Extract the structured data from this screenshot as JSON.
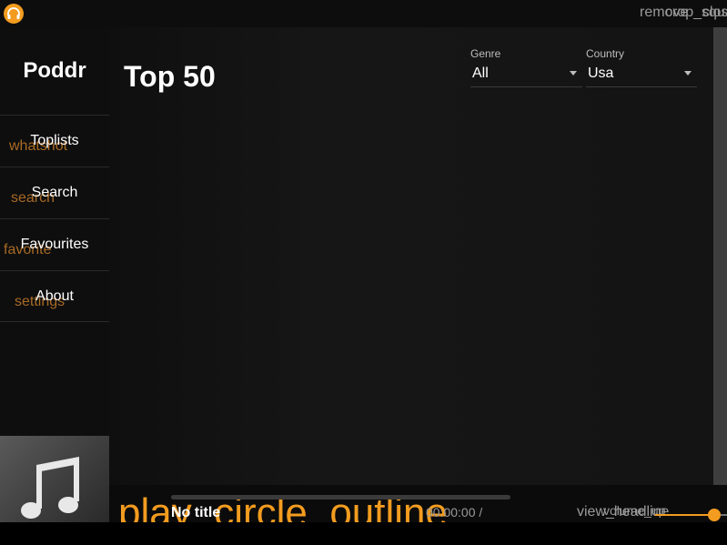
{
  "titlebar": {
    "app_icon": "headphones-icon",
    "minimize_label": "remove",
    "maximize_label": "crop_square",
    "close_label": "close"
  },
  "sidebar": {
    "brand": "Poddr",
    "items": [
      {
        "icon": "whatshot",
        "label": "Toplists"
      },
      {
        "icon": "search",
        "label": "Search"
      },
      {
        "icon": "favorite",
        "label": "Favourites"
      },
      {
        "icon": "settings",
        "label": "About"
      }
    ],
    "cover_icon": "music-note-icon"
  },
  "main": {
    "title": "Top 50",
    "genre": {
      "label": "Genre",
      "value": "All"
    },
    "country": {
      "label": "Country",
      "value": "Usa"
    }
  },
  "player": {
    "play_icon": "play_circle_outline",
    "title": "No title",
    "time": "00:00:00 /",
    "queue_icon": "view_headline",
    "volume_icon": "volume_up",
    "volume_level": 0.82,
    "accent": "#f39c1f"
  }
}
